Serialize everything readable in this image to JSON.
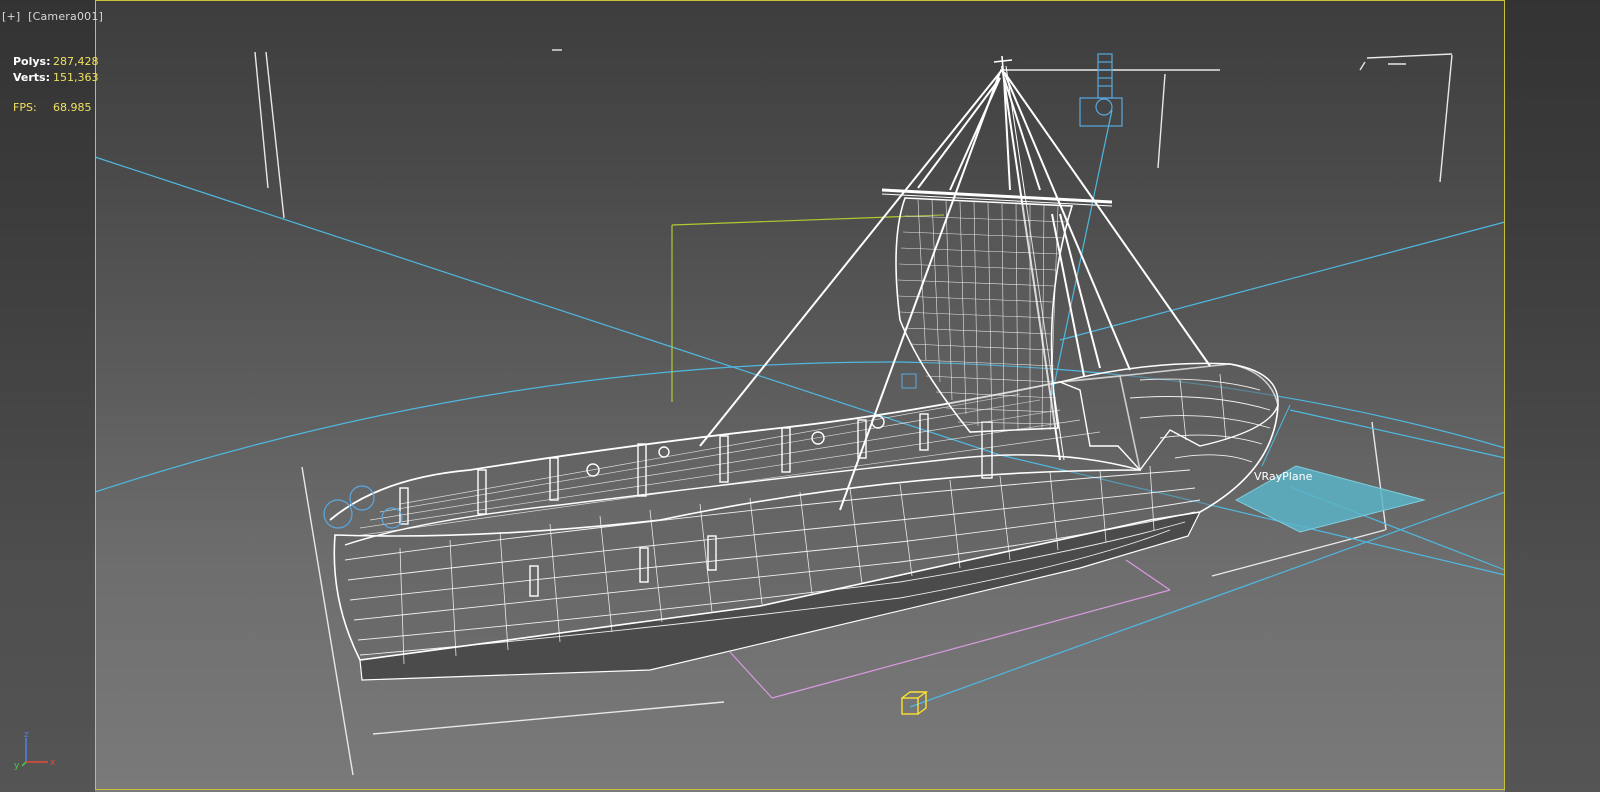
{
  "viewport": {
    "menu_label": "[+]",
    "camera_label": "[Camera001]"
  },
  "stats": {
    "polys_label": "Polys:",
    "polys_value": "287,428",
    "verts_label": "Verts:",
    "verts_value": "151,363",
    "fps_label": "FPS:",
    "fps_value": "68.985"
  },
  "scene_objects": {
    "vray_plane_label": "VRayPlane"
  },
  "gizmo": {
    "x_label": "x",
    "y_label": "y",
    "z_label": "z"
  },
  "colors": {
    "wireframe": "#ffffff",
    "helper_blue": "#4fb8e0",
    "safe_frame": "#c8c23a",
    "stats_value": "#f0e060",
    "vray_plane_fill": "#5ab4c8",
    "light_yellow": "#ffe030",
    "bounding_pink": "#d89ae0",
    "bounding_green": "#b4c832"
  },
  "icons": {
    "light": "omni-light-icon",
    "camera": "camera-icon",
    "axis": "axis-tripod-icon"
  }
}
